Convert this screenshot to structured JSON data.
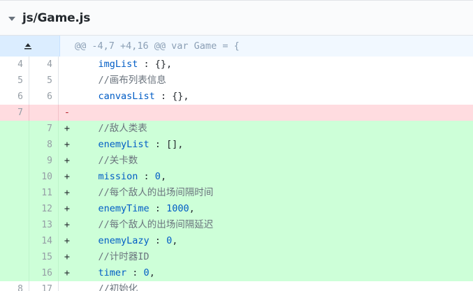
{
  "file": {
    "path": "js/Game.js"
  },
  "hunk": {
    "header": "@@ -4,7 +4,16 @@ var Game = {"
  },
  "lines": [
    {
      "type": "ctx",
      "old": "4",
      "new": "4",
      "marker": "",
      "tokens": [
        {
          "t": "    imgList",
          "c": "kw"
        },
        {
          "t": " : {},",
          "c": "pn"
        }
      ]
    },
    {
      "type": "ctx",
      "old": "5",
      "new": "5",
      "marker": "",
      "tokens": [
        {
          "t": "    //画布列表信息",
          "c": "cm"
        }
      ]
    },
    {
      "type": "ctx",
      "old": "6",
      "new": "6",
      "marker": "",
      "tokens": [
        {
          "t": "    canvasList",
          "c": "kw"
        },
        {
          "t": " : {},",
          "c": "pn"
        }
      ]
    },
    {
      "type": "del",
      "old": "7",
      "new": "",
      "marker": "-",
      "tokens": []
    },
    {
      "type": "add",
      "old": "",
      "new": "7",
      "marker": "+",
      "tokens": [
        {
          "t": "    //敌人类表",
          "c": "cm"
        }
      ]
    },
    {
      "type": "add",
      "old": "",
      "new": "8",
      "marker": "+",
      "tokens": [
        {
          "t": "    enemyList",
          "c": "kw"
        },
        {
          "t": " : [],",
          "c": "pn"
        }
      ]
    },
    {
      "type": "add",
      "old": "",
      "new": "9",
      "marker": "+",
      "tokens": [
        {
          "t": "    //关卡数",
          "c": "cm"
        }
      ]
    },
    {
      "type": "add",
      "old": "",
      "new": "10",
      "marker": "+",
      "tokens": [
        {
          "t": "    mission",
          "c": "kw"
        },
        {
          "t": " : ",
          "c": "pn"
        },
        {
          "t": "0",
          "c": "nm"
        },
        {
          "t": ",",
          "c": "pn"
        }
      ]
    },
    {
      "type": "add",
      "old": "",
      "new": "11",
      "marker": "+",
      "tokens": [
        {
          "t": "    //每个敌人的出场间隔时间",
          "c": "cm"
        }
      ]
    },
    {
      "type": "add",
      "old": "",
      "new": "12",
      "marker": "+",
      "tokens": [
        {
          "t": "    enemyTime",
          "c": "kw"
        },
        {
          "t": " : ",
          "c": "pn"
        },
        {
          "t": "1000",
          "c": "nm"
        },
        {
          "t": ",",
          "c": "pn"
        }
      ]
    },
    {
      "type": "add",
      "old": "",
      "new": "13",
      "marker": "+",
      "tokens": [
        {
          "t": "    //每个敌人的出场间隔延迟",
          "c": "cm"
        }
      ]
    },
    {
      "type": "add",
      "old": "",
      "new": "14",
      "marker": "+",
      "tokens": [
        {
          "t": "    enemyLazy",
          "c": "kw"
        },
        {
          "t": " : ",
          "c": "pn"
        },
        {
          "t": "0",
          "c": "nm"
        },
        {
          "t": ",",
          "c": "pn"
        }
      ]
    },
    {
      "type": "add",
      "old": "",
      "new": "15",
      "marker": "+",
      "tokens": [
        {
          "t": "    //计时器ID",
          "c": "cm"
        }
      ]
    },
    {
      "type": "add",
      "old": "",
      "new": "16",
      "marker": "+",
      "tokens": [
        {
          "t": "    timer",
          "c": "kw"
        },
        {
          "t": " : ",
          "c": "pn"
        },
        {
          "t": "0",
          "c": "nm"
        },
        {
          "t": ",",
          "c": "pn"
        }
      ]
    },
    {
      "type": "ctx",
      "old": "8",
      "new": "17",
      "marker": "",
      "tokens": [
        {
          "t": "    //初始化",
          "c": "cm"
        }
      ]
    }
  ],
  "icons": {
    "collapse": "chevron-down-icon",
    "expand": "expand-up-icon"
  },
  "colors": {
    "added_bg": "#cdffd8",
    "deleted_bg": "#ffdce0",
    "hunk_bg": "#f1f8ff"
  }
}
